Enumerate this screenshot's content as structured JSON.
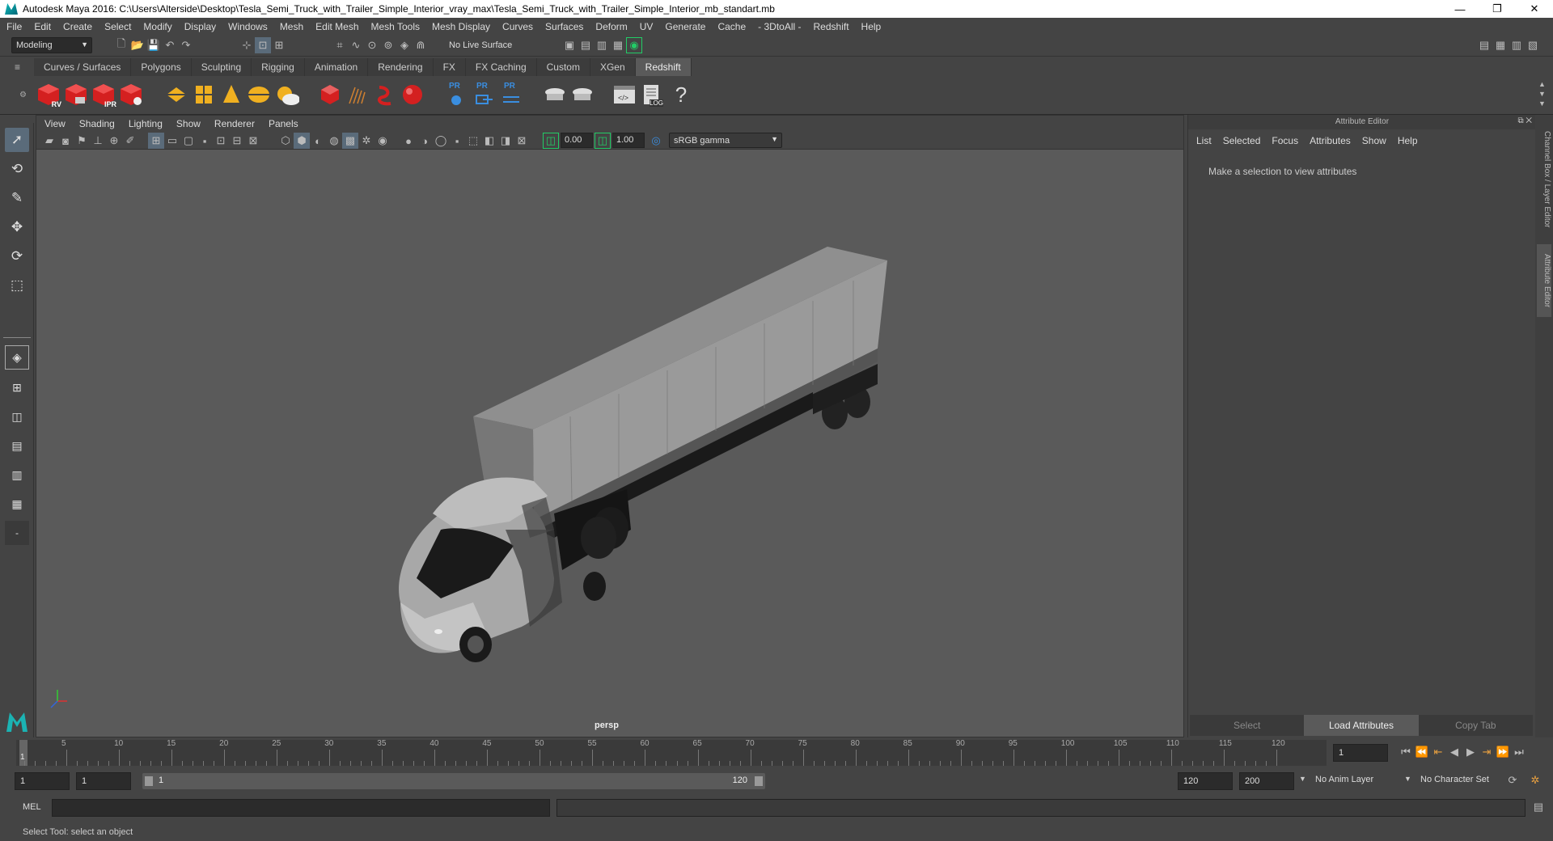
{
  "window": {
    "title": "Autodesk Maya 2016: C:\\Users\\Alterside\\Desktop\\Tesla_Semi_Truck_with_Trailer_Simple_Interior_vray_max\\Tesla_Semi_Truck_with_Trailer_Simple_Interior_mb_standart.mb",
    "minimize": "—",
    "restore": "❐",
    "close": "✕"
  },
  "menus": [
    "File",
    "Edit",
    "Create",
    "Select",
    "Modify",
    "Display",
    "Windows",
    "Mesh",
    "Edit Mesh",
    "Mesh Tools",
    "Mesh Display",
    "Curves",
    "Surfaces",
    "Deform",
    "UV",
    "Generate",
    "Cache",
    "- 3DtoAll -",
    "Redshift",
    "Help"
  ],
  "status": {
    "mode": "Modeling",
    "live_surface": "No Live Surface"
  },
  "shelf_tabs": [
    "Curves / Surfaces",
    "Polygons",
    "Sculpting",
    "Rigging",
    "Animation",
    "Rendering",
    "FX",
    "FX Caching",
    "Custom",
    "XGen",
    "Redshift"
  ],
  "shelf_active": "Redshift",
  "shelf_labels": {
    "rv": "RV",
    "ipr": "IPR",
    "pr1": "PR",
    "pr2": "PR",
    "pr3": "PR",
    "log": "LOG"
  },
  "viewport": {
    "menus": [
      "View",
      "Shading",
      "Lighting",
      "Show",
      "Renderer",
      "Panels"
    ],
    "exposure": "0.00",
    "gamma": "1.00",
    "colorspace": "sRGB gamma",
    "camera": "persp"
  },
  "attribute_editor": {
    "title": "Attribute Editor",
    "menus": [
      "List",
      "Selected",
      "Focus",
      "Attributes",
      "Show",
      "Help"
    ],
    "message": "Make a selection to view attributes",
    "buttons": [
      "Select",
      "Load Attributes",
      "Copy Tab"
    ]
  },
  "side_tabs": [
    "Channel Box / Layer Editor",
    "Attribute Editor"
  ],
  "timeline": {
    "ticks": [
      "5",
      "10",
      "15",
      "20",
      "25",
      "30",
      "35",
      "40",
      "45",
      "50",
      "55",
      "60",
      "65",
      "70",
      "75",
      "80",
      "85",
      "90",
      "95",
      "100",
      "105",
      "110",
      "115",
      "120"
    ],
    "current_frame": "1",
    "current_label": "1"
  },
  "range": {
    "start": "1",
    "start2": "1",
    "slider_start": "1",
    "slider_end": "120",
    "end": "120",
    "max": "200",
    "anim_layer": "No Anim Layer",
    "char_set": "No Character Set"
  },
  "command": {
    "label": "MEL"
  },
  "help_line": "Select Tool: select an object",
  "colors": {
    "accent_active": "#5a5a5a",
    "viewport_bg": "#5a5a5a",
    "redshift_red": "#d42020"
  }
}
